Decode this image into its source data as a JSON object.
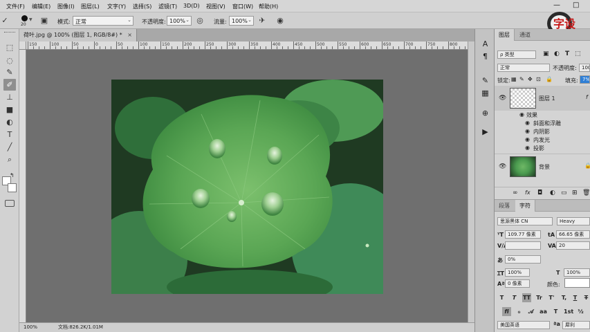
{
  "menu": [
    "文件(F)",
    "编辑(E)",
    "图像(I)",
    "图层(L)",
    "文字(Y)",
    "选择(S)",
    "滤镜(T)",
    "3D(D)",
    "视图(V)",
    "窗口(W)",
    "帮助(H)"
  ],
  "window_controls": {
    "minimize": "—",
    "restore": "□"
  },
  "options": {
    "brush_size": "20",
    "mode_label": "模式:",
    "mode_value": "正常",
    "opacity_label": "不透明度:",
    "opacity_value": "100%",
    "flow_label": "流量:",
    "flow_value": "100%"
  },
  "document": {
    "tab_title": "荷叶.jpg @ 100% (图层 1, RGB/8#) *",
    "close": "×",
    "ruler_labels": [
      "150",
      "100",
      "50",
      "0",
      "50",
      "100",
      "150",
      "200",
      "250",
      "300",
      "350",
      "400",
      "450",
      "500",
      "550",
      "600",
      "650",
      "700",
      "750",
      "800"
    ],
    "zoom": "100%",
    "doc_info": "文档:826.2K/1.01M"
  },
  "layers_panel": {
    "tabs": [
      "图层",
      "通道"
    ],
    "filter_value": "ρ 类型",
    "blend_mode": "正常",
    "opacity_label": "不透明度:",
    "opacity_value": "100",
    "lock_label": "锁定:",
    "fill_label": "填充:",
    "fill_value": "7%",
    "layer1_name": "图层 1",
    "effects_label": "效果",
    "effects": [
      "斜面和浮雕",
      "内阴影",
      "内发光",
      "投影"
    ],
    "background_name": "背景"
  },
  "character_panel": {
    "tabs": [
      "段落",
      "字符"
    ],
    "font_family": "思源黑体 CN",
    "font_style": "Heavy",
    "font_size": "109.77 像素",
    "leading": "66.65 像素",
    "kerning": "V/A",
    "tracking": "20",
    "scale_pct": "0%",
    "vertical_scale": "100%",
    "horizontal_scale": "100%",
    "baseline": "0 像素",
    "color_label": "颜色:",
    "language": "美国英语",
    "antialias": "犀利",
    "style_buttons": [
      "T",
      "T",
      "TT",
      "Tr",
      "T'",
      "T,",
      "T",
      "T"
    ],
    "opentype_first": "fi"
  },
  "watermark_text": "字设",
  "colors": {
    "accent_fill": "#2f7fd6",
    "layer_selected": "#c6c6c6"
  }
}
